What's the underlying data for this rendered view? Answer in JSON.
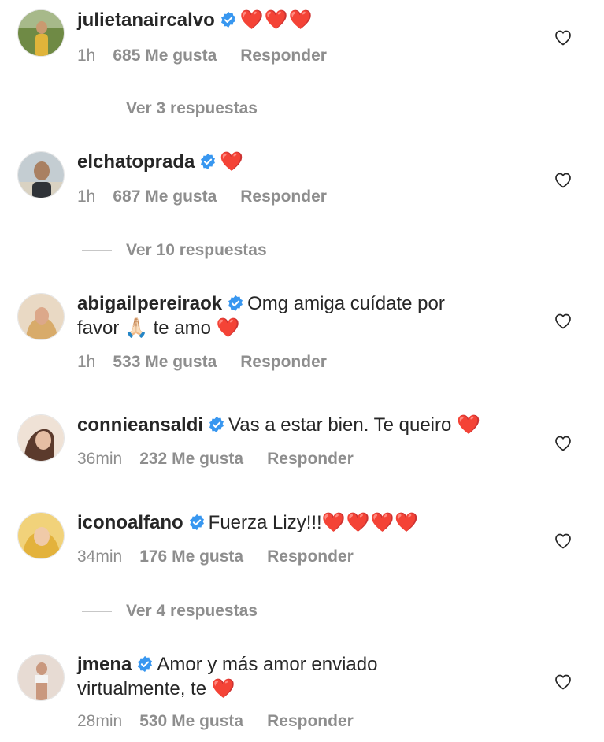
{
  "comments": [
    {
      "username": "julietanaircalvo",
      "text": "",
      "hearts": "❤️❤️❤️",
      "time": "1h",
      "likes": "685 Me gusta",
      "reply": "Responder",
      "view_replies": "Ver 3 respuestas",
      "avatar_colors": [
        "#9a8a55",
        "#5f7a3a"
      ]
    },
    {
      "username": "elchatoprada",
      "text": "",
      "hearts": "❤️",
      "time": "1h",
      "likes": "687 Me gusta",
      "reply": "Responder",
      "view_replies": "Ver 10 respuestas",
      "avatar_colors": [
        "#b9c3c8",
        "#4a4f55"
      ]
    },
    {
      "username": "abigailpereiraok",
      "text_line1": "Omg amiga cuídate por",
      "text_line2_a": "favor",
      "text_emoji_pray": "🙏🏻",
      "text_line2_b": "te amo",
      "hearts": "❤️",
      "time": "1h",
      "likes": "533 Me gusta",
      "reply": "Responder",
      "avatar_colors": [
        "#d9b27a",
        "#8a5a3a"
      ]
    },
    {
      "username": "connieansaldi",
      "text": "Vas a estar bien. Te queiro",
      "hearts": "❤️",
      "time": "36min",
      "likes": "232 Me gusta",
      "reply": "Responder",
      "avatar_colors": [
        "#e8c7b0",
        "#6b4a3a"
      ]
    },
    {
      "username": "iconoalfano",
      "text": "Fuerza Lizy!!!",
      "hearts": "❤️❤️❤️❤️",
      "time": "34min",
      "likes": "176 Me gusta",
      "reply": "Responder",
      "view_replies": "Ver 4 respuestas",
      "avatar_colors": [
        "#e8c050",
        "#b08020"
      ]
    },
    {
      "username": "jmena",
      "text_line1": "Amor y más amor enviado",
      "text_line2": "virtualmente, te",
      "hearts": "❤️",
      "time": "28min",
      "likes": "530 Me gusta",
      "reply": "Responder",
      "avatar_colors": [
        "#c9a898",
        "#7a5a4a"
      ]
    }
  ],
  "colors": {
    "verified": "#3897f0",
    "meta_text": "#8e8e8e",
    "heart": "#ed1c24"
  },
  "icons": {
    "like": "heart-outline-icon",
    "verified": "verified-badge-icon"
  }
}
